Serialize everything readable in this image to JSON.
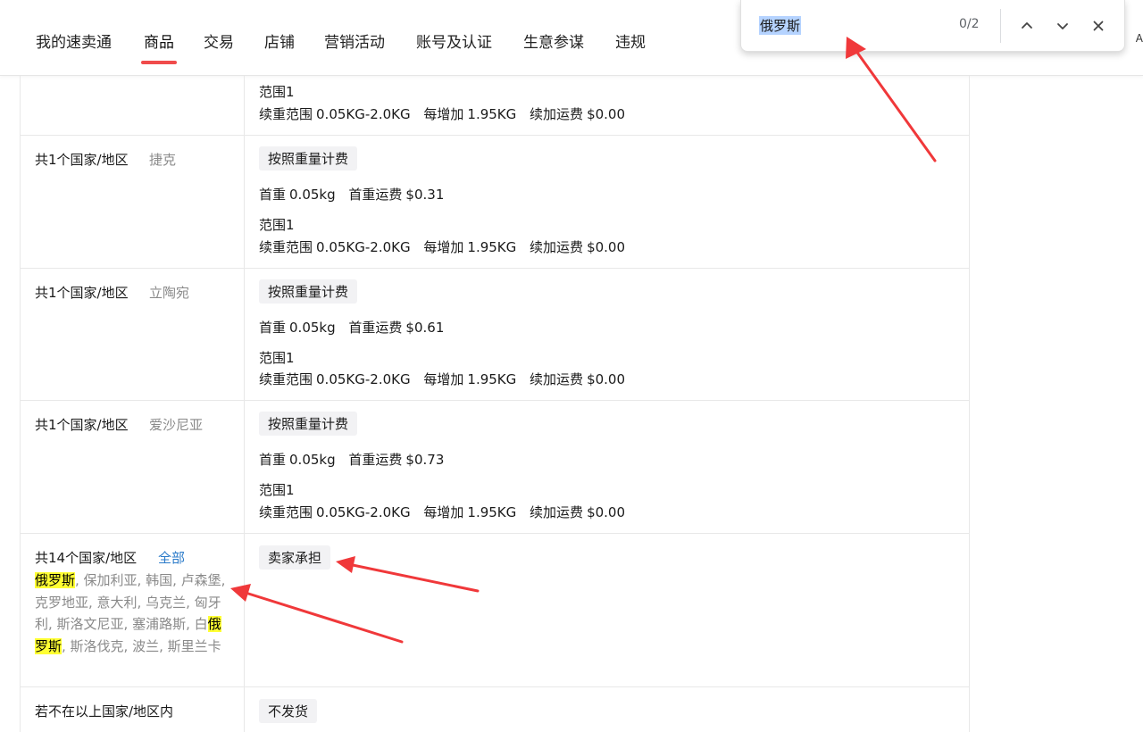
{
  "nav": {
    "items": [
      "我的速卖通",
      "商品",
      "交易",
      "店铺",
      "营销活动",
      "账号及认证",
      "生意参谋",
      "违规"
    ],
    "active_index": 1,
    "edge_glyph": "A"
  },
  "find_bar": {
    "query": "俄罗斯",
    "count": "0/2",
    "icons": [
      "chevron-up-icon",
      "chevron-down-icon",
      "close-icon"
    ]
  },
  "table": {
    "partial_row": {
      "range_label": "范围1",
      "continued": {
        "range_k": "续重范围",
        "range_v": "0.05KG-2.0KG",
        "step_k": "每增加",
        "step_v": "1.95KG",
        "fee_k": "续加运费",
        "fee_v": "$0.00"
      }
    },
    "rows": [
      {
        "count_label": "共1个国家/地区",
        "country": "捷克",
        "method": "按照重量计费",
        "first_weight_k": "首重",
        "first_weight_v": "0.05kg",
        "first_fee_k": "首重运费",
        "first_fee_v": "$0.31",
        "range_label": "范围1",
        "range_k": "续重范围",
        "range_v": "0.05KG-2.0KG",
        "step_k": "每增加",
        "step_v": "1.95KG",
        "fee_k": "续加运费",
        "fee_v": "$0.00"
      },
      {
        "count_label": "共1个国家/地区",
        "country": "立陶宛",
        "method": "按照重量计费",
        "first_weight_k": "首重",
        "first_weight_v": "0.05kg",
        "first_fee_k": "首重运费",
        "first_fee_v": "$0.61",
        "range_label": "范围1",
        "range_k": "续重范围",
        "range_v": "0.05KG-2.0KG",
        "step_k": "每增加",
        "step_v": "1.95KG",
        "fee_k": "续加运费",
        "fee_v": "$0.00"
      },
      {
        "count_label": "共1个国家/地区",
        "country": "爱沙尼亚",
        "method": "按照重量计费",
        "first_weight_k": "首重",
        "first_weight_v": "0.05kg",
        "first_fee_k": "首重运费",
        "first_fee_v": "$0.73",
        "range_label": "范围1",
        "range_k": "续重范围",
        "range_v": "0.05KG-2.0KG",
        "step_k": "每增加",
        "step_v": "1.95KG",
        "fee_k": "续加运费",
        "fee_v": "$0.00"
      }
    ],
    "group_row": {
      "count_label": "共14个国家/地区",
      "all_link": "全部",
      "countries_text": [
        "俄罗斯",
        ", 保加利亚, 韩国, 卢森堡, 克罗地亚, 意大利, 乌克兰, 匈牙利, 斯洛文尼亚, 塞浦路斯, 白",
        "俄罗斯",
        ", 斯洛伐克, 波兰, 斯里兰卡"
      ],
      "method": "卖家承担"
    },
    "fallback_row": {
      "label": "若不在以上国家/地区内",
      "method": "不发货"
    }
  },
  "colors": {
    "nav_underline": "#f04b4b",
    "highlight": "#ffff33",
    "link": "#2a7ac9",
    "annotation_arrow": "#f0383a"
  }
}
